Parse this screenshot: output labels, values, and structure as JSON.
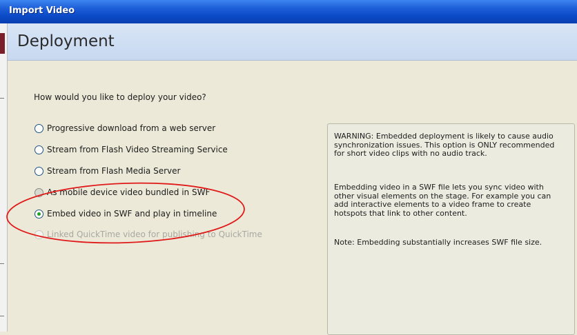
{
  "window": {
    "title": "Import Video"
  },
  "header": {
    "heading": "Deployment"
  },
  "question": "How would you like to deploy your video?",
  "options": [
    {
      "label": "Progressive download from a web server",
      "selected": false,
      "enabled": true
    },
    {
      "label": "Stream from Flash Video Streaming Service",
      "selected": false,
      "enabled": true
    },
    {
      "label": "Stream from Flash Media Server",
      "selected": false,
      "enabled": true
    },
    {
      "label": "As mobile device video bundled in SWF",
      "selected": false,
      "enabled": true
    },
    {
      "label": "Embed video in SWF and play in timeline",
      "selected": true,
      "enabled": true
    },
    {
      "label": "Linked QuickTime video for publishing to QuickTime",
      "selected": false,
      "enabled": false
    }
  ],
  "info": {
    "warning": "WARNING: Embedded deployment is likely to cause audio synchronization issues. This option is ONLY recommended for short video clips with no audio track.",
    "description": "Embedding video in a SWF file lets you sync video with other visual elements on the stage. For example you can add interactive elements to a video frame to create hotspots that link to other content.",
    "note": "Note: Embedding substantially increases SWF file size."
  },
  "colors": {
    "titlebar": "#0b49c6",
    "header": "#c7d8f0",
    "annotation": "#e01818",
    "radio_selected": "#21a121"
  }
}
